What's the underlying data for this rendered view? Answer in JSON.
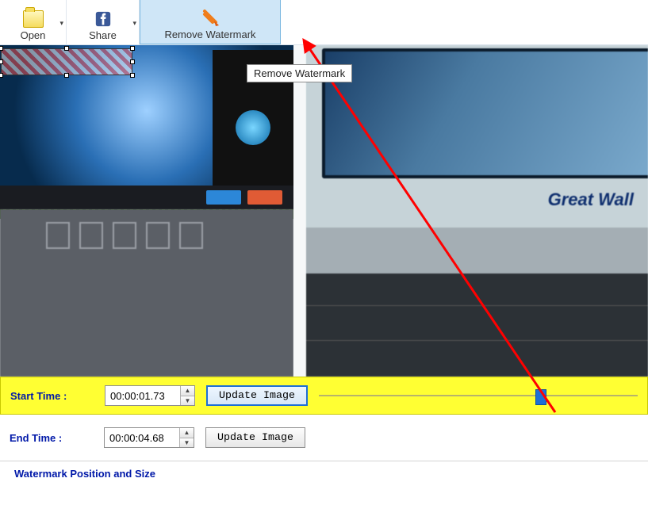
{
  "toolbar": {
    "open_label": "Open",
    "share_label": "Share",
    "remove_watermark_label": "Remove Watermark"
  },
  "tooltip": {
    "remove_watermark": "Remove Watermark"
  },
  "preview": {
    "monitor_brand": "Great Wall"
  },
  "time": {
    "start_label": "Start Time :",
    "start_value": "00:00:01.73",
    "start_update_label": "Update Image",
    "end_label": "End Time :",
    "end_value": "00:00:04.68",
    "end_update_label": "Update Image",
    "slider_percent": 68
  },
  "section": {
    "position_size_title": "Watermark Position and Size"
  }
}
